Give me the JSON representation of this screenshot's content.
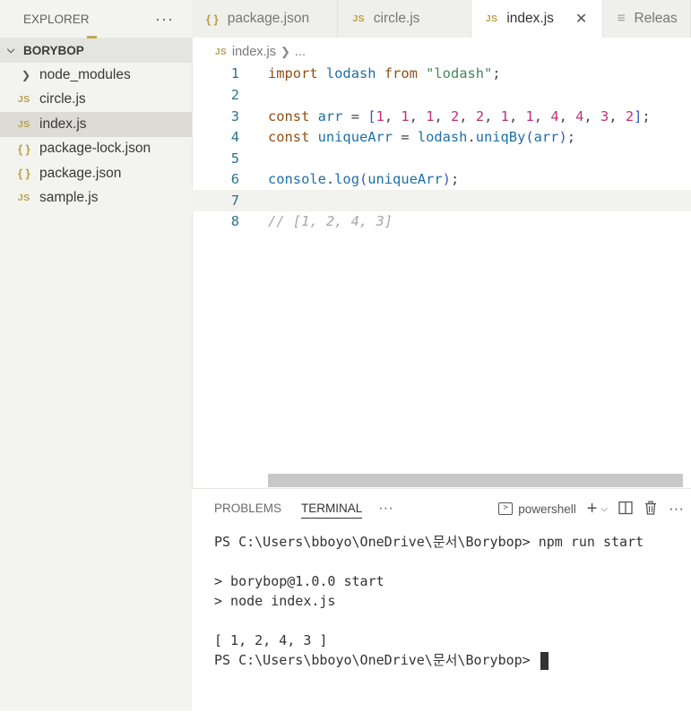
{
  "explorer": {
    "title": "EXPLORER",
    "project": "BORYBOP",
    "items": [
      {
        "label": "node_modules",
        "icon": "chevron-right-icon",
        "type": "folder"
      },
      {
        "label": "circle.js",
        "icon": "js-file-icon",
        "type": "js"
      },
      {
        "label": "index.js",
        "icon": "js-file-icon",
        "type": "js",
        "selected": true
      },
      {
        "label": "package-lock.json",
        "icon": "json-file-icon",
        "type": "json"
      },
      {
        "label": "package.json",
        "icon": "json-file-icon",
        "type": "json"
      },
      {
        "label": "sample.js",
        "icon": "js-file-icon",
        "type": "js"
      }
    ]
  },
  "tabs": [
    {
      "label": "package.json",
      "icon": "json-file-icon"
    },
    {
      "label": "circle.js",
      "icon": "js-file-icon"
    },
    {
      "label": "index.js",
      "icon": "js-file-icon",
      "active": true
    },
    {
      "label": "Releas",
      "icon": "preview-icon"
    }
  ],
  "breadcrumb": {
    "file": "index.js",
    "rest": "..."
  },
  "editor": {
    "line_numbers": [
      "1",
      "2",
      "3",
      "4",
      "5",
      "6",
      "7",
      "8"
    ],
    "current_line": 7,
    "lines": [
      [
        [
          "kw",
          "import"
        ],
        [
          "pu",
          " "
        ],
        [
          "id",
          "lodash"
        ],
        [
          "pu",
          " "
        ],
        [
          "kw",
          "from"
        ],
        [
          "pu",
          " "
        ],
        [
          "st",
          "\"lodash\""
        ],
        [
          "pu",
          ";"
        ]
      ],
      [],
      [
        [
          "kw",
          "const"
        ],
        [
          "pu",
          " "
        ],
        [
          "id",
          "arr"
        ],
        [
          "pu",
          " = "
        ],
        [
          "br",
          "["
        ],
        [
          "nu",
          "1"
        ],
        [
          "pu",
          ", "
        ],
        [
          "nu",
          "1"
        ],
        [
          "pu",
          ", "
        ],
        [
          "nu",
          "1"
        ],
        [
          "pu",
          ", "
        ],
        [
          "nu",
          "2"
        ],
        [
          "pu",
          ", "
        ],
        [
          "nu",
          "2"
        ],
        [
          "pu",
          ", "
        ],
        [
          "nu",
          "1"
        ],
        [
          "pu",
          ", "
        ],
        [
          "nu",
          "1"
        ],
        [
          "pu",
          ", "
        ],
        [
          "nu",
          "4"
        ],
        [
          "pu",
          ", "
        ],
        [
          "nu",
          "4"
        ],
        [
          "pu",
          ", "
        ],
        [
          "nu",
          "3"
        ],
        [
          "pu",
          ", "
        ],
        [
          "nu",
          "2"
        ],
        [
          "br",
          "]"
        ],
        [
          "pu",
          ";"
        ]
      ],
      [
        [
          "kw",
          "const"
        ],
        [
          "pu",
          " "
        ],
        [
          "id",
          "uniqueArr"
        ],
        [
          "pu",
          " = "
        ],
        [
          "id",
          "lodash"
        ],
        [
          "pu",
          "."
        ],
        [
          "id",
          "uniqBy"
        ],
        [
          "br",
          "("
        ],
        [
          "id",
          "arr"
        ],
        [
          "br",
          ")"
        ],
        [
          "pu",
          ";"
        ]
      ],
      [],
      [
        [
          "id",
          "console"
        ],
        [
          "pu",
          "."
        ],
        [
          "id",
          "log"
        ],
        [
          "br",
          "("
        ],
        [
          "id",
          "uniqueArr"
        ],
        [
          "br",
          ")"
        ],
        [
          "pu",
          ";"
        ]
      ],
      [],
      [
        [
          "cm",
          "// [1, 2, 4, 3]"
        ]
      ]
    ]
  },
  "panel": {
    "tabs": [
      "PROBLEMS",
      "TERMINAL"
    ],
    "active_tab": "TERMINAL",
    "more": "···",
    "terminal_name": "powershell",
    "terminal_lines": [
      "PS C:\\Users\\bboyo\\OneDrive\\문서\\Borybop> npm run start",
      "",
      "> borybop@1.0.0 start",
      "> node index.js",
      "",
      "[ 1, 2, 4, 3 ]",
      "PS C:\\Users\\bboyo\\OneDrive\\문서\\Borybop> "
    ]
  },
  "icons": {
    "js": "JS",
    "json": "{ }",
    "more": "···"
  }
}
